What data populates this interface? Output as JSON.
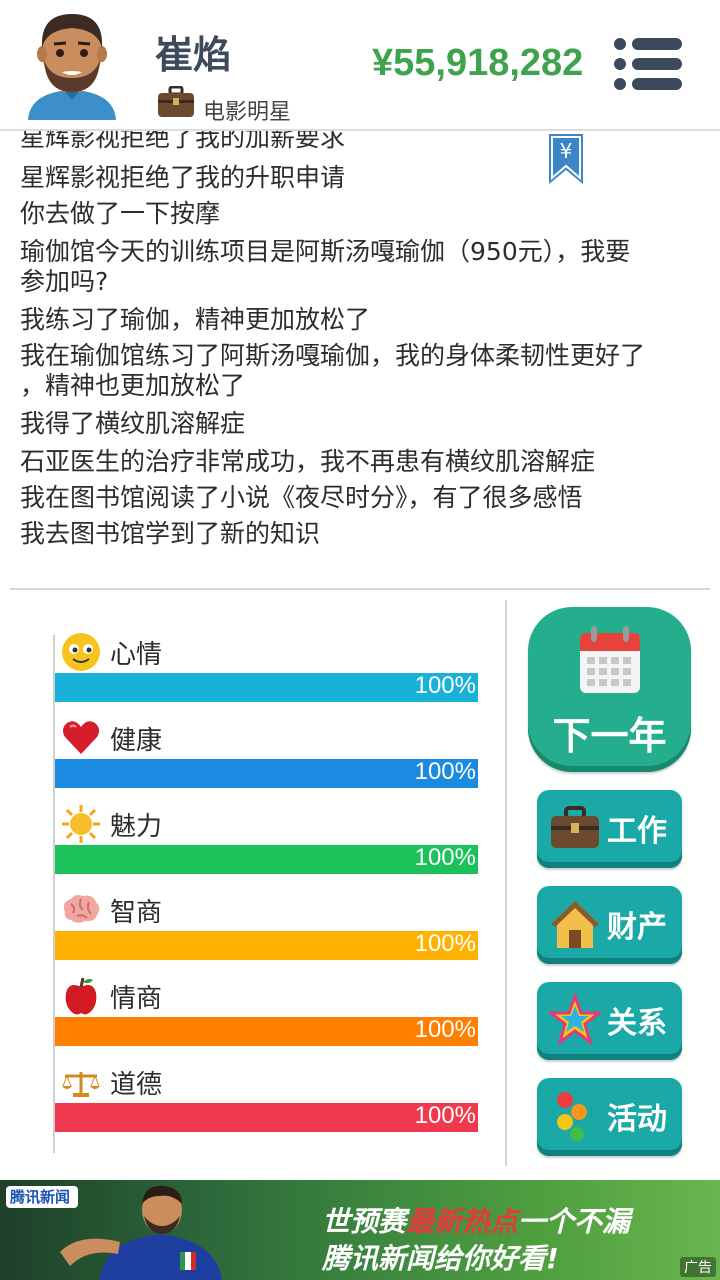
{
  "header": {
    "name": "崔焰",
    "job": "电影明星",
    "money": "¥55,918,282"
  },
  "log": {
    "bookmark_symbol": "¥",
    "lines": [
      "星辉影视拒绝了我的加薪要求",
      "星辉影视拒绝了我的升职申请",
      "你去做了一下按摩",
      "瑜伽馆今天的训练项目是阿斯汤嘎瑜伽（950元），我要",
      "参加吗?",
      "我练习了瑜伽，精神更加放松了",
      "我在瑜伽馆练习了阿斯汤嘎瑜伽，我的身体柔韧性更好了",
      "，精神也更加放松了",
      "我得了横纹肌溶解症",
      "石亚医生的治疗非常成功，我不再患有横纹肌溶解症",
      "我在图书馆阅读了小说《夜尽时分》，有了很多感悟",
      "我去图书馆学到了新的知识"
    ]
  },
  "stats": [
    {
      "label": "心情",
      "value_text": "100%",
      "value": 1.0,
      "color": "#1ab1d9",
      "icon": "smiley-icon"
    },
    {
      "label": "健康",
      "value_text": "100%",
      "value": 1.0,
      "color": "#1a8be0",
      "icon": "heart-icon"
    },
    {
      "label": "魅力",
      "value_text": "100%",
      "value": 1.0,
      "color": "#1cc259",
      "icon": "sun-icon"
    },
    {
      "label": "智商",
      "value_text": "100%",
      "value": 1.0,
      "color": "#ffb300",
      "icon": "brain-icon"
    },
    {
      "label": "情商",
      "value_text": "100%",
      "value": 1.0,
      "color": "#ff7f00",
      "icon": "apple-icon"
    },
    {
      "label": "道德",
      "value_text": "100%",
      "value": 1.0,
      "color": "#f0384e",
      "icon": "scales-icon"
    }
  ],
  "actions": {
    "next_year": "下一年",
    "work": "工作",
    "property": "财产",
    "relations": "关系",
    "activities": "活动"
  },
  "ad": {
    "brand": "腾讯新闻",
    "line1_prefix": "世预赛",
    "line1_hot": "最新热点",
    "line1_suffix": "一个不漏",
    "line2": "腾讯新闻给你好看!",
    "tag": "广告"
  },
  "colors": {
    "money": "#3fa34d",
    "next_year_button": "#24ae8d",
    "side_button": "#1aa9a6"
  }
}
